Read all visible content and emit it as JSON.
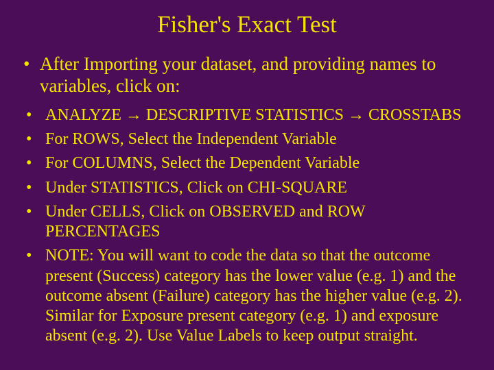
{
  "title": "Fisher's Exact Test",
  "intro": "After Importing your dataset, and providing names to variables, click on:",
  "steps": {
    "s1a": "ANALYZE ",
    "s1b": " DESCRIPTIVE STATISTICS ",
    "s1c": " CROSSTABS",
    "s2": "For ROWS, Select the Independent Variable",
    "s3": "For COLUMNS, Select the Dependent Variable",
    "s4": "Under STATISTICS, Click on CHI-SQUARE",
    "s5": "Under CELLS, Click on OBSERVED and ROW PERCENTAGES",
    "s6": "NOTE: You will want to code the data so that the outcome present (Success) category has the lower value (e.g. 1) and the outcome absent (Failure) category has the higher value (e.g. 2). Similar for Exposure present category (e.g. 1) and exposure absent (e.g. 2). Use Value Labels to keep output straight."
  },
  "arrow": "→"
}
